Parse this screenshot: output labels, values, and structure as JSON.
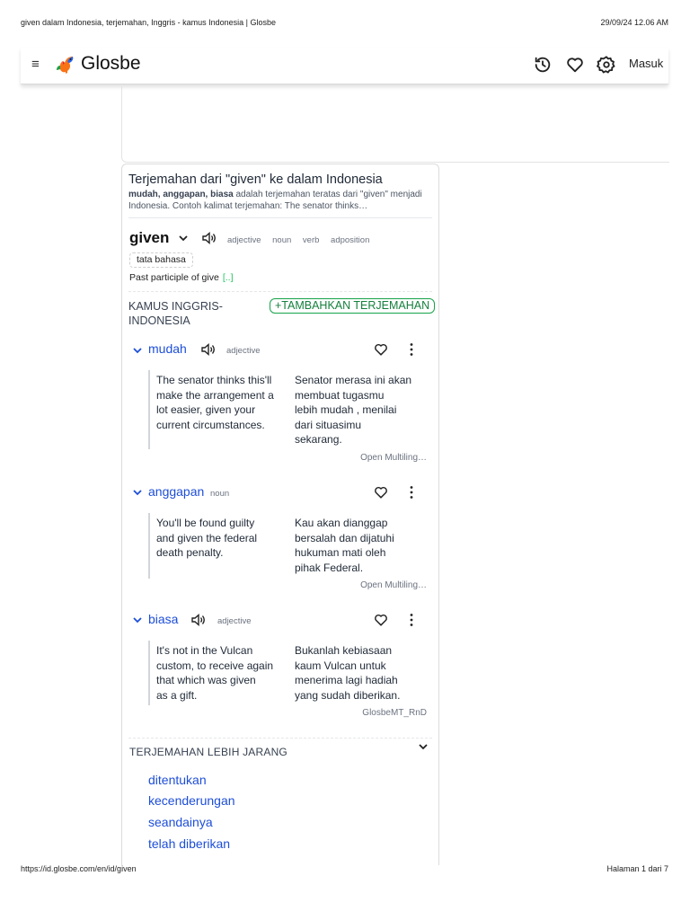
{
  "print_header": {
    "title": "given dalam Indonesia, terjemahan, Inggris - kamus Indonesia | Glosbe",
    "datetime": "29/09/24 12.06 AM"
  },
  "print_footer": {
    "url": "https://id.glosbe.com/en/id/given",
    "page": "Halaman 1 dari 7"
  },
  "app": {
    "name": "Glosbe",
    "login": "Masuk"
  },
  "icons": {
    "menu": "menu-icon",
    "logo": "glosbe-bird-logo",
    "history": "history-icon",
    "favorites": "heart-icon",
    "settings": "gear-icon"
  },
  "colors": {
    "accent_blue": "#1d4ed8",
    "accent_green": "#16a34a"
  },
  "card": {
    "title": "Terjemahan dari \"given\" ke dalam Indonesia",
    "summary_bold": "mudah, anggapan, biasa",
    "summary_rest": " adalah terjemahan teratas dari \"given\" menjadi Indonesia. Contoh kalimat terjemahan: The senator thinks…",
    "headword": "given",
    "pos": [
      "adjective",
      "noun",
      "verb",
      "adposition"
    ],
    "grammar_tag": "tata bahasa",
    "definition": "Past participle of give",
    "definition_link": "[..]",
    "dictionary_label": "KAMUS INGGRIS-INDONESIA",
    "add_button": "+TAMBAHKAN TERJEMAHAN",
    "entries": [
      {
        "word": "mudah",
        "pos": "adjective",
        "example_en": "The senator thinks this'll\nmake the arrangement a\nlot easier,  given  your\ncurrent circumstances.",
        "example_id": "Senator merasa ini akan\nmembuat tugasmu\nlebih  mudah , menilai\ndari situasimu\nsekarang.",
        "source": "Open Multiling…"
      },
      {
        "word": "anggapan",
        "pos": "noun",
        "example_en": "You'll be found guilty\nand  given  the federal\ndeath penalty.",
        "example_id": "Kau akan  dianggap\nbersalah dan dijatuhi\nhukuman mati oleh\npihak Federal.",
        "source": "Open Multiling…"
      },
      {
        "word": "biasa",
        "pos": "adjective",
        "example_en": "It's not in the Vulcan\ncustom, to receive again\nthat which was  given\nas a gift.",
        "example_id": "Bukanlah  kebiasaan\nkaum Vulcan untuk\nmenerima lagi hadiah\nyang sudah diberikan.",
        "source": "GlosbeMT_RnD"
      }
    ],
    "rare_label": "TERJEMAHAN LEBIH JARANG",
    "rare": [
      "ditentukan",
      "kecenderungan",
      "seandainya",
      "telah diberikan"
    ]
  }
}
